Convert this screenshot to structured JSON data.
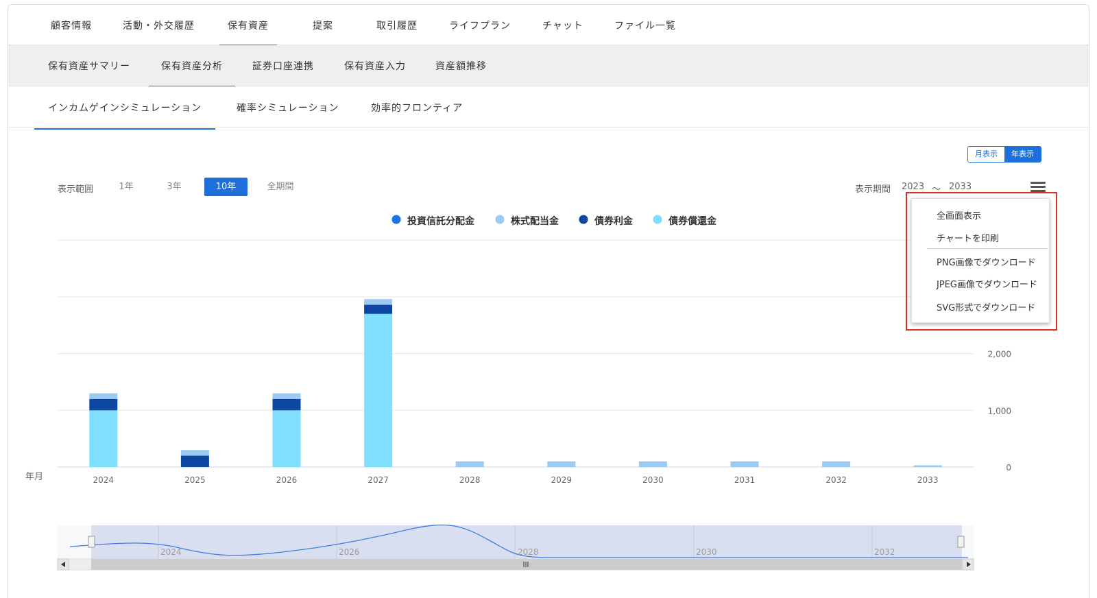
{
  "nav": {
    "primary": [
      {
        "label": "顧客情報",
        "active": false
      },
      {
        "label": "活動・外交履歴",
        "active": false
      },
      {
        "label": "保有資産",
        "active": true
      },
      {
        "label": "提案",
        "active": false
      },
      {
        "label": "取引履歴",
        "active": false
      },
      {
        "label": "ライフプラン",
        "active": false
      },
      {
        "label": "チャット",
        "active": false
      },
      {
        "label": "ファイル一覧",
        "active": false
      }
    ],
    "secondary": [
      {
        "label": "保有資産サマリー",
        "active": false
      },
      {
        "label": "保有資産分析",
        "active": true
      },
      {
        "label": "証券口座連携",
        "active": false
      },
      {
        "label": "保有資産入力",
        "active": false
      },
      {
        "label": "資産額推移",
        "active": false
      }
    ],
    "tertiary": [
      {
        "label": "インカムゲインシミュレーション",
        "active": true
      },
      {
        "label": "確率シミュレーション",
        "active": false
      },
      {
        "label": "効率的フロンティア",
        "active": false
      }
    ]
  },
  "view_toggle": {
    "monthly": "月表示",
    "yearly": "年表示",
    "selected": "yearly"
  },
  "range": {
    "label": "表示範囲",
    "options": [
      "1年",
      "3年",
      "10年",
      "全期間"
    ],
    "selected": "10年"
  },
  "period": {
    "label": "表示期間",
    "from": "2023",
    "sep": "〜",
    "to": "2033"
  },
  "export_menu": {
    "items": [
      "全画面表示",
      "チャートを印刷",
      "PNG画像でダウンロード",
      "JPEG画像でダウンロード",
      "SVG形式でダウンロード"
    ]
  },
  "chart_data": {
    "type": "bar",
    "stacked": true,
    "xlabel": "年月",
    "categories": [
      "2024",
      "2025",
      "2026",
      "2027",
      "2028",
      "2029",
      "2030",
      "2031",
      "2032",
      "2033"
    ],
    "y_ticks": [
      "0",
      "1,000",
      "2,000"
    ],
    "ylim": [
      0,
      4000
    ],
    "series": [
      {
        "name": "債券償還金",
        "color": "#80deff",
        "values": [
          1000,
          0,
          1000,
          2700,
          0,
          0,
          0,
          0,
          0,
          0
        ]
      },
      {
        "name": "債券利金",
        "color": "#0d47a1",
        "values": [
          200,
          200,
          200,
          160,
          0,
          0,
          0,
          0,
          0,
          0
        ]
      },
      {
        "name": "株式配当金",
        "color": "#9ccaf0",
        "values": [
          100,
          100,
          100,
          100,
          100,
          100,
          100,
          100,
          100,
          30
        ]
      },
      {
        "name": "投資信託分配金",
        "color": "#1a73e8",
        "values": [
          0,
          0,
          0,
          0,
          0,
          0,
          0,
          0,
          0,
          0
        ]
      }
    ],
    "legend_order": [
      "投資信託分配金",
      "株式配当金",
      "債券利金",
      "債券償還金"
    ],
    "legend_placement": "top-center",
    "navigator": {
      "labels": [
        "2024",
        "2026",
        "2028",
        "2030",
        "2032"
      ]
    }
  }
}
